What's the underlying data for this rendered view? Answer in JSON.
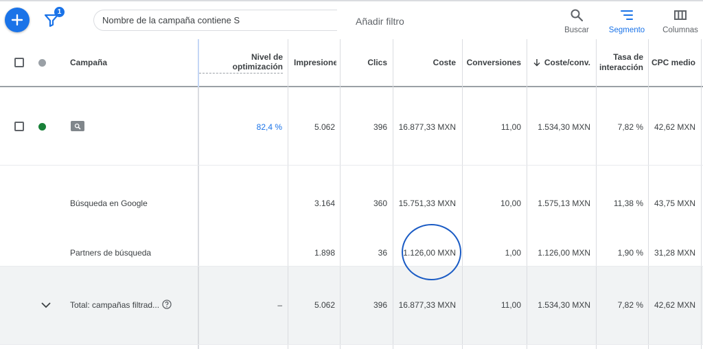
{
  "toolbar": {
    "filter_count": "1",
    "filter_chip": "Nombre de la campaña contiene S",
    "add_filter": "Añadir filtro",
    "tools": [
      {
        "label": "Buscar",
        "icon": "search-icon"
      },
      {
        "label": "Segmento",
        "icon": "segment-icon",
        "active": true
      },
      {
        "label": "Columnas",
        "icon": "columns-icon"
      }
    ]
  },
  "columns": {
    "campaign": "Campaña",
    "optimization": "Nivel de optimización",
    "impressions": "Impresiones",
    "clicks": "Clics",
    "cost": "Coste",
    "conversions": "Conversiones",
    "cost_conv": "Coste/conv.",
    "interaction_rate_1": "Tasa de",
    "interaction_rate_2": "interacción",
    "avg_cpc": "CPC medio"
  },
  "campaign_row": {
    "optimization": "82,4 %",
    "impressions": "5.062",
    "clicks": "396",
    "cost": "16.877,33 MXN",
    "conversions": "11,00",
    "cost_conv": "1.534,30 MXN",
    "interaction_rate": "7,82 %",
    "avg_cpc": "42,62 MXN"
  },
  "segments": [
    {
      "name": "Búsqueda en Google",
      "impressions": "3.164",
      "clicks": "360",
      "cost": "15.751,33 MXN",
      "conversions": "10,00",
      "cost_conv": "1.575,13 MXN",
      "interaction_rate": "11,38 %",
      "avg_cpc": "43,75 MXN"
    },
    {
      "name": "Partners de búsqueda",
      "impressions": "1.898",
      "clicks": "36",
      "cost": "1.126,00 MXN",
      "conversions": "1,00",
      "cost_conv": "1.126,00 MXN",
      "interaction_rate": "1,90 %",
      "avg_cpc": "31,28 MXN"
    }
  ],
  "total_row": {
    "label": "Total: campañas filtrad...",
    "optimization": "–",
    "impressions": "5.062",
    "clicks": "396",
    "cost": "16.877,33 MXN",
    "conversions": "11,00",
    "cost_conv": "1.534,30 MXN",
    "interaction_rate": "7,82 %",
    "avg_cpc": "42,62 MXN"
  },
  "colors": {
    "accent": "#1a73e8",
    "enabled_status": "#188038",
    "header_status": "#9aa0a6"
  }
}
